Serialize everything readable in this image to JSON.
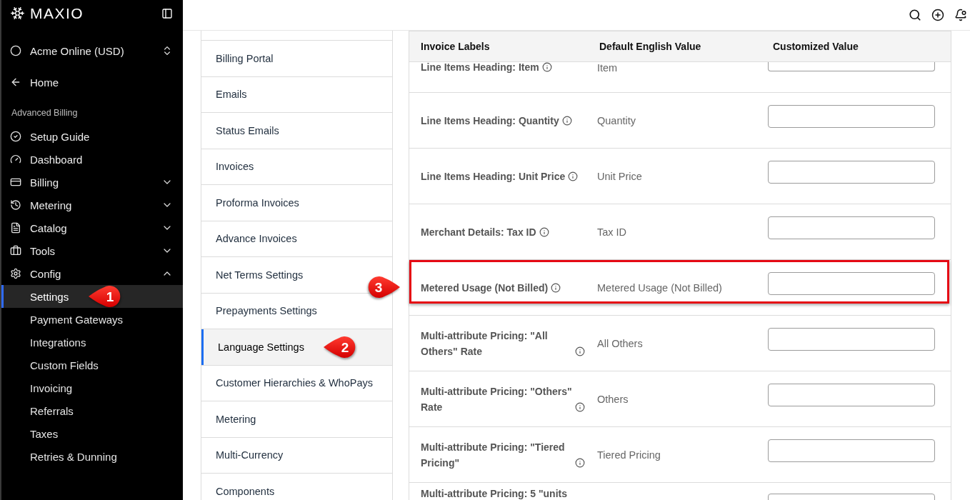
{
  "brand": {
    "name": "MAXIO"
  },
  "account": {
    "name": "Acme Online (USD)"
  },
  "home_link": {
    "label": "Home"
  },
  "sidebar": {
    "section_title": "Advanced Billing",
    "items": [
      {
        "label": "Setup Guide",
        "kind": "link"
      },
      {
        "label": "Dashboard",
        "kind": "link"
      },
      {
        "label": "Billing",
        "kind": "group",
        "expanded": false
      },
      {
        "label": "Metering",
        "kind": "group",
        "expanded": false
      },
      {
        "label": "Catalog",
        "kind": "group",
        "expanded": false
      },
      {
        "label": "Tools",
        "kind": "group",
        "expanded": false
      },
      {
        "label": "Config",
        "kind": "group",
        "expanded": true,
        "children": [
          {
            "label": "Settings",
            "selected": true,
            "callout": "1"
          },
          {
            "label": "Payment Gateways",
            "selected": false
          },
          {
            "label": "Integrations",
            "selected": false
          },
          {
            "label": "Custom Fields",
            "selected": false
          },
          {
            "label": "Invoicing",
            "selected": false
          },
          {
            "label": "Referrals",
            "selected": false
          },
          {
            "label": "Taxes",
            "selected": false
          },
          {
            "label": "Retries & Dunning",
            "selected": false
          }
        ]
      }
    ]
  },
  "settings_menu": {
    "items": [
      {
        "label": "Billing Portal",
        "selected": false
      },
      {
        "label": "Emails",
        "selected": false
      },
      {
        "label": "Status Emails",
        "selected": false
      },
      {
        "label": "Invoices",
        "selected": false
      },
      {
        "label": "Proforma Invoices",
        "selected": false
      },
      {
        "label": "Advance Invoices",
        "selected": false
      },
      {
        "label": "Net Terms Settings",
        "selected": false
      },
      {
        "label": "Prepayments Settings",
        "selected": false
      },
      {
        "label": "Language Settings",
        "selected": true,
        "callout": "2"
      },
      {
        "label": "Customer Hierarchies & WhoPays",
        "selected": false
      },
      {
        "label": "Metering",
        "selected": false
      },
      {
        "label": "Multi-Currency",
        "selected": false
      },
      {
        "label": "Components",
        "selected": false
      }
    ]
  },
  "table": {
    "columns": [
      "Invoice Labels",
      "Default English Value",
      "Customized Value"
    ],
    "rows": [
      {
        "label": "Line Items Heading: Item",
        "default_value": "Item",
        "highlighted": false
      },
      {
        "label": "Line Items Heading: Quantity",
        "default_value": "Quantity",
        "highlighted": false
      },
      {
        "label": "Line Items Heading: Unit Price",
        "default_value": "Unit Price",
        "highlighted": false
      },
      {
        "label": "Merchant Details: Tax ID",
        "default_value": "Tax ID",
        "highlighted": false
      },
      {
        "label": "Metered Usage (Not Billed)",
        "default_value": "Metered Usage (Not Billed)",
        "highlighted": true,
        "callout": "3"
      },
      {
        "label": "Multi-attribute Pricing: \"All Others\" Rate",
        "default_value": "All Others",
        "highlighted": false
      },
      {
        "label": "Multi-attribute Pricing: \"Others\" Rate",
        "default_value": "Others",
        "highlighted": false
      },
      {
        "label": "Multi-attribute Pricing: \"Tiered Pricing\"",
        "default_value": "Tiered Pricing",
        "highlighted": false
      },
      {
        "label": "Multi-attribute Pricing: 5 \"units",
        "highlighted": false
      }
    ]
  }
}
